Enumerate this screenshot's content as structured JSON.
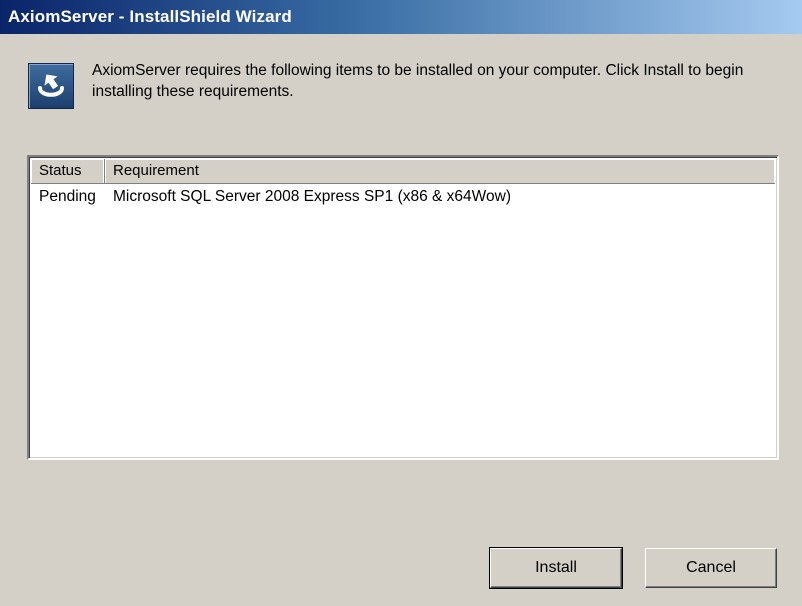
{
  "window": {
    "title": "AxiomServer - InstallShield Wizard"
  },
  "header": {
    "icon": "installshield-setup-icon",
    "message": "AxiomServer requires the following items to be installed on your computer. Click Install to begin installing these requirements."
  },
  "requirements": {
    "columns": [
      "Status",
      "Requirement"
    ],
    "rows": [
      {
        "status": "Pending",
        "requirement": "Microsoft SQL Server 2008 Express SP1 (x86 & x64Wow)"
      }
    ]
  },
  "buttons": {
    "install_label": "Install",
    "cancel_label": "Cancel"
  },
  "colors": {
    "titlebar_start": "#0a246a",
    "titlebar_end": "#a6caf0",
    "dialog_background": "#d4d0c8"
  }
}
